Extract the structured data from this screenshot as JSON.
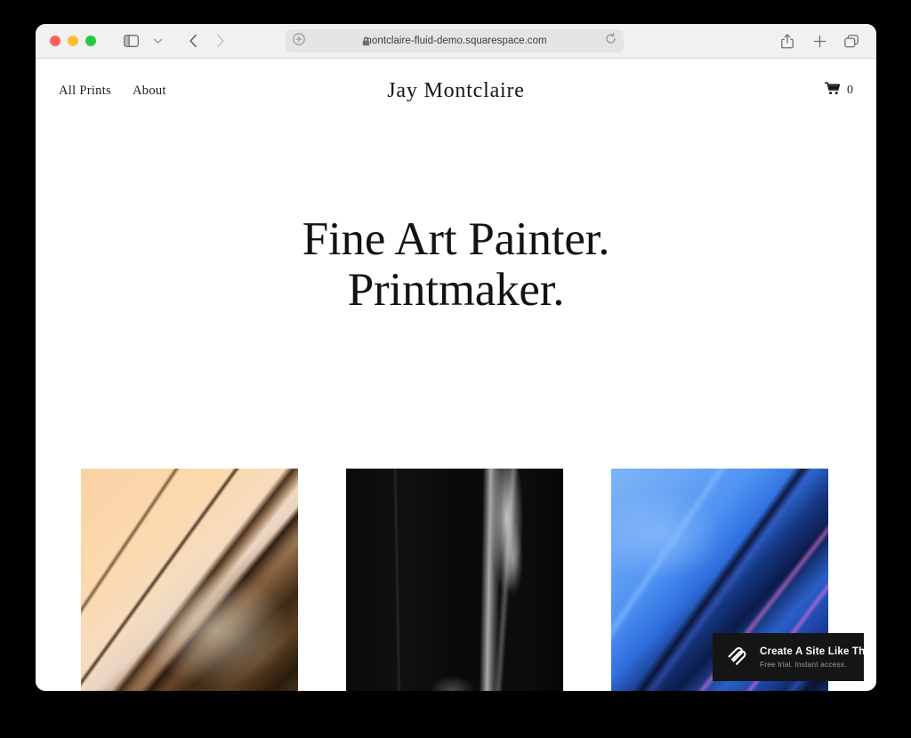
{
  "browser": {
    "traffic_lights": [
      "close",
      "minimize",
      "zoom"
    ],
    "sidebar_toggle_icon": "sidebar-icon",
    "tab_overview_chevron_icon": "chevron-down-icon",
    "back_icon": "chevron-left-icon",
    "forward_icon": "chevron-right-icon",
    "address": {
      "reader_icon": "reader-toggle-icon",
      "lock_icon": "lock-icon",
      "url": "montclaire-fluid-demo.squarespace.com",
      "reload_icon": "reload-icon"
    },
    "actions": {
      "share_icon": "share-icon",
      "new_tab_icon": "plus-icon",
      "tabs_icon": "tab-overview-icon"
    }
  },
  "site": {
    "nav": [
      {
        "label": "All Prints"
      },
      {
        "label": "About"
      }
    ],
    "title": "Jay Montclaire",
    "cart": {
      "icon": "shopping-cart-icon",
      "count": "0"
    },
    "hero": {
      "line1": "Fine Art Painter.",
      "line2": "Printmaker."
    },
    "gallery": [
      {
        "name": "peach-brown-fluid-artwork",
        "alt": "Peach and brown flowing paint artwork"
      },
      {
        "name": "black-smoke-artwork",
        "alt": "Black artwork with pale smoke streak"
      },
      {
        "name": "blue-fluid-artwork",
        "alt": "Vivid blue fluid artwork with magenta accents"
      }
    ]
  },
  "badge": {
    "logo_icon": "squarespace-logo-icon",
    "title": "Create A Site Like This",
    "subtitle": "Free trial. Instant access."
  },
  "colors": {
    "toolbar_bg": "#f1f1f1",
    "address_bg": "#e4e4e4",
    "page_bg": "#ffffff",
    "text": "#161616",
    "badge_bg": "#151515",
    "desktop_bg": "#000000"
  }
}
